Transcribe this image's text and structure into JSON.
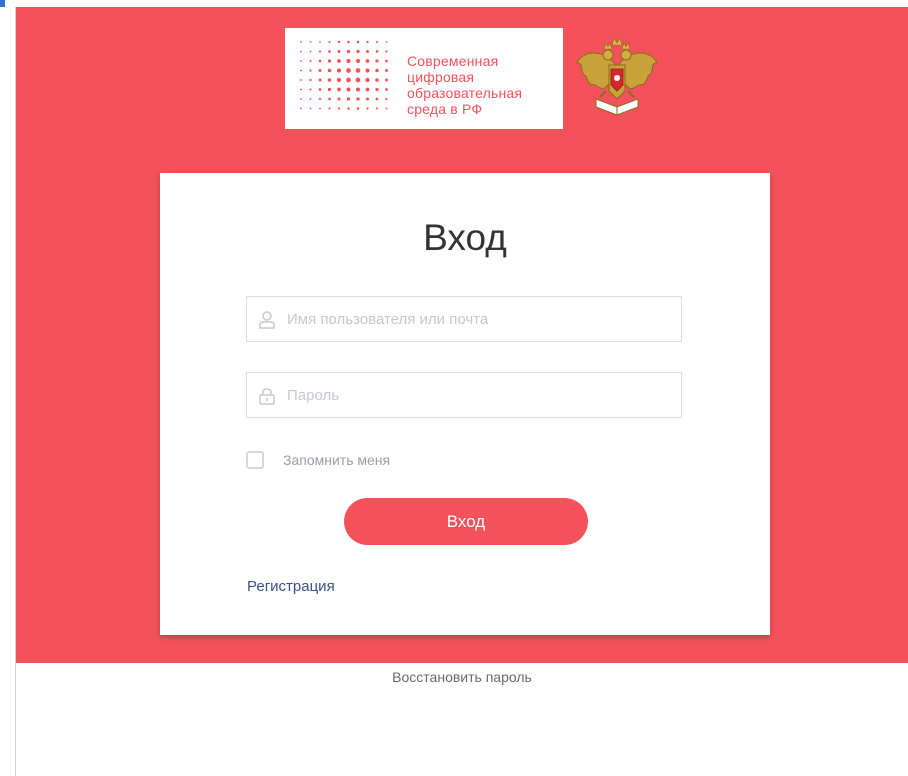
{
  "logo": {
    "text_lines": [
      "Современная",
      "цифровая",
      "образовательная",
      "среда в РФ"
    ],
    "icon": "dot-grid-logo",
    "emblem_icon": "coat-of-arms-icon"
  },
  "login": {
    "title": "Вход",
    "username_placeholder": "Имя пользователя или почта",
    "username_value": "",
    "password_placeholder": "Пароль",
    "password_value": "",
    "user_icon": "user-icon",
    "lock_icon": "lock-icon",
    "remember_label": "Запомнить меня",
    "remember_checked": false,
    "submit_label": "Вход",
    "register_link": "Регистрация"
  },
  "footer": {
    "restore_link": "Восстановить пароль"
  },
  "colors": {
    "accent": "#f4525a",
    "link": "#3a5288",
    "background": "#ffffff"
  }
}
